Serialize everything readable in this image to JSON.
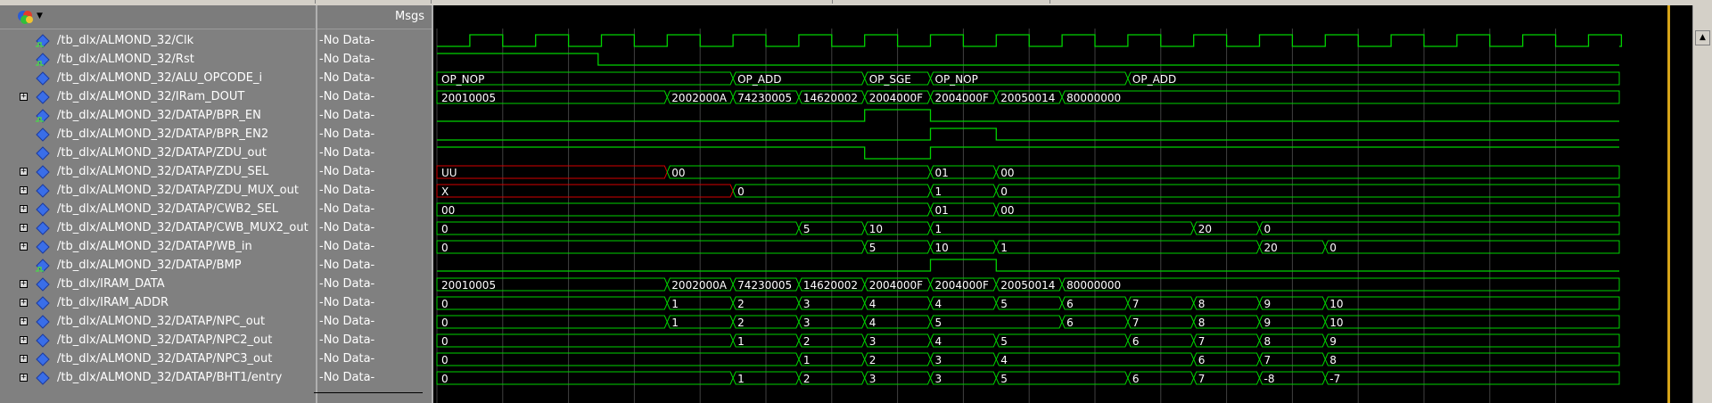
{
  "header": {
    "msgs_label": "Msgs"
  },
  "colors": {
    "wave": "#00d200",
    "invalid": "#d40000",
    "text": "#ffffff",
    "cursor": "#d6a318",
    "grid": "#404040"
  },
  "icons": {
    "toolbar": "wave-logo-icon",
    "dropdown": "dropdown-arrow-icon",
    "signal": "diamond-signal-icon",
    "clock": "clock-signal-icon",
    "expand": "expand-plus-icon",
    "scroll_up": "scroll-up-arrow-icon"
  },
  "signals": [
    {
      "name": "/tb_dlx/ALMOND_32/Clk",
      "msg": "-No Data-",
      "expandable": false,
      "kind": "clock"
    },
    {
      "name": "/tb_dlx/ALMOND_32/Rst",
      "msg": "-No Data-",
      "expandable": false,
      "kind": "clock"
    },
    {
      "name": "/tb_dlx/ALMOND_32/ALU_OPCODE_i",
      "msg": "-No Data-",
      "expandable": false,
      "kind": "signal"
    },
    {
      "name": "/tb_dlx/ALMOND_32/IRam_DOUT",
      "msg": "-No Data-",
      "expandable": true,
      "kind": "signal"
    },
    {
      "name": "/tb_dlx/ALMOND_32/DATAP/BPR_EN",
      "msg": "-No Data-",
      "expandable": false,
      "kind": "clock"
    },
    {
      "name": "/tb_dlx/ALMOND_32/DATAP/BPR_EN2",
      "msg": "-No Data-",
      "expandable": false,
      "kind": "signal"
    },
    {
      "name": "/tb_dlx/ALMOND_32/DATAP/ZDU_out",
      "msg": "-No Data-",
      "expandable": false,
      "kind": "signal"
    },
    {
      "name": "/tb_dlx/ALMOND_32/DATAP/ZDU_SEL",
      "msg": "-No Data-",
      "expandable": true,
      "kind": "signal"
    },
    {
      "name": "/tb_dlx/ALMOND_32/DATAP/ZDU_MUX_out",
      "msg": "-No Data-",
      "expandable": true,
      "kind": "signal"
    },
    {
      "name": "/tb_dlx/ALMOND_32/DATAP/CWB2_SEL",
      "msg": "-No Data-",
      "expandable": true,
      "kind": "signal"
    },
    {
      "name": "/tb_dlx/ALMOND_32/DATAP/CWB_MUX2_out",
      "msg": "-No Data-",
      "expandable": true,
      "kind": "signal"
    },
    {
      "name": "/tb_dlx/ALMOND_32/DATAP/WB_in",
      "msg": "-No Data-",
      "expandable": true,
      "kind": "signal"
    },
    {
      "name": "/tb_dlx/ALMOND_32/DATAP/BMP",
      "msg": "-No Data-",
      "expandable": false,
      "kind": "clock"
    },
    {
      "name": "/tb_dlx/IRAM_DATA",
      "msg": "-No Data-",
      "expandable": true,
      "kind": "signal"
    },
    {
      "name": "/tb_dlx/IRAM_ADDR",
      "msg": "-No Data-",
      "expandable": true,
      "kind": "signal"
    },
    {
      "name": "/tb_dlx/ALMOND_32/DATAP/NPC_out",
      "msg": "-No Data-",
      "expandable": true,
      "kind": "signal"
    },
    {
      "name": "/tb_dlx/ALMOND_32/DATAP/NPC2_out",
      "msg": "-No Data-",
      "expandable": true,
      "kind": "signal"
    },
    {
      "name": "/tb_dlx/ALMOND_32/DATAP/NPC3_out",
      "msg": "-No Data-",
      "expandable": true,
      "kind": "signal"
    },
    {
      "name": "/tb_dlx/ALMOND_32/DATAP/BHT1/entry",
      "msg": "-No Data-",
      "expandable": true,
      "kind": "signal"
    }
  ],
  "wave_values": {
    "ALU_OPCODE_i": [
      "OP_NOP",
      "OP_ADD",
      "OP_SGE",
      "OP_NOP",
      "OP_ADD"
    ],
    "IRam_DOUT": [
      "20010005",
      "2002000A",
      "74230005",
      "14620002",
      "2004000F",
      "2004000F",
      "20050014",
      "80000000"
    ],
    "ZDU_SEL": [
      "UU",
      "00",
      "01",
      "00"
    ],
    "ZDU_MUX_out": [
      "X",
      "0",
      "1",
      "0"
    ],
    "CWB2_SEL": [
      "00",
      "01",
      "00"
    ],
    "CWB_MUX2_out": [
      "0",
      "5",
      "10",
      "1",
      "20",
      "0"
    ],
    "WB_in": [
      "0",
      "5",
      "10",
      "1",
      "20",
      "0"
    ],
    "IRAM_DATA": [
      "20010005",
      "2002000A",
      "74230005",
      "14620002",
      "2004000F",
      "2004000F",
      "20050014",
      "80000000"
    ],
    "IRAM_ADDR": [
      "0",
      "1",
      "2",
      "3",
      "4",
      "4",
      "5",
      "6",
      "7",
      "8",
      "9",
      "10"
    ],
    "NPC_out": [
      "0",
      "1",
      "2",
      "3",
      "4",
      "5",
      "6",
      "7",
      "8",
      "9",
      "10"
    ],
    "NPC2_out": [
      "0",
      "1",
      "2",
      "3",
      "4",
      "5",
      "6",
      "7",
      "8",
      "9"
    ],
    "NPC3_out": [
      "0",
      "1",
      "2",
      "3",
      "4",
      "6",
      "7",
      "8"
    ],
    "BHT1_entry": [
      "0",
      "1",
      "2",
      "3",
      "3",
      "5",
      "6",
      "7",
      "-8",
      "-7"
    ]
  }
}
